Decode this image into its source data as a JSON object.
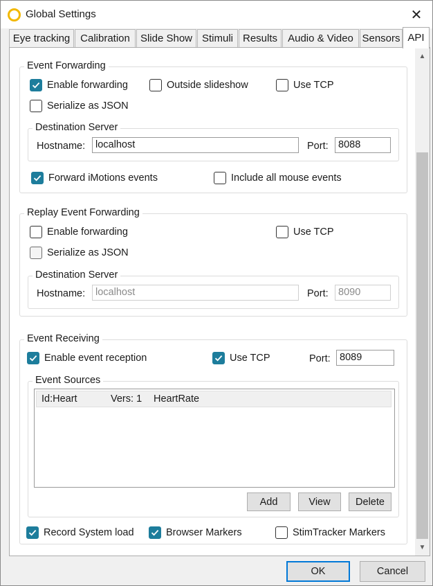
{
  "window": {
    "title": "Global Settings"
  },
  "tabs": [
    {
      "label": "Eye tracking"
    },
    {
      "label": "Calibration"
    },
    {
      "label": "Slide Show"
    },
    {
      "label": "Stimuli"
    },
    {
      "label": "Results"
    },
    {
      "label": "Audio & Video"
    },
    {
      "label": "Sensors"
    },
    {
      "label": "API",
      "active": true
    }
  ],
  "event_forwarding": {
    "title": "Event Forwarding",
    "enable_forwarding": {
      "label": "Enable forwarding",
      "checked": true
    },
    "outside_slideshow": {
      "label": "Outside slideshow",
      "checked": false
    },
    "use_tcp": {
      "label": "Use TCP",
      "checked": false
    },
    "serialize_json": {
      "label": "Serialize as JSON",
      "checked": false
    },
    "destination": {
      "title": "Destination Server",
      "hostname_label": "Hostname:",
      "hostname_value": "localhost",
      "port_label": "Port:",
      "port_value": "8088"
    },
    "forward_imotions": {
      "label": "Forward iMotions events",
      "checked": true
    },
    "include_mouse": {
      "label": "Include all mouse events",
      "checked": false
    }
  },
  "replay_forwarding": {
    "title": "Replay Event Forwarding",
    "enable_forwarding": {
      "label": "Enable forwarding",
      "checked": false
    },
    "use_tcp": {
      "label": "Use TCP",
      "checked": false
    },
    "serialize_json": {
      "label": "Serialize as JSON",
      "checked": false
    },
    "destination": {
      "title": "Destination Server",
      "hostname_label": "Hostname:",
      "hostname_value": "localhost",
      "port_label": "Port:",
      "port_value": "8090"
    }
  },
  "event_receiving": {
    "title": "Event Receiving",
    "enable_reception": {
      "label": "Enable event reception",
      "checked": true
    },
    "use_tcp": {
      "label": "Use TCP",
      "checked": true
    },
    "port_label": "Port:",
    "port_value": "8089",
    "sources": {
      "title": "Event Sources",
      "rows": [
        {
          "id": "Id:Heart",
          "version": "Vers: 1",
          "name": "HeartRate"
        }
      ],
      "add_label": "Add",
      "view_label": "View",
      "delete_label": "Delete"
    }
  },
  "bottom_options": {
    "record_system_load": {
      "label": "Record System load",
      "checked": true
    },
    "browser_markers": {
      "label": "Browser Markers",
      "checked": true
    },
    "stimtracker_markers": {
      "label": "StimTracker Markers",
      "checked": false
    }
  },
  "footer": {
    "ok_label": "OK",
    "cancel_label": "Cancel"
  },
  "colors": {
    "accent": "#1d7d9c",
    "default_button_border": "#0078d7"
  }
}
